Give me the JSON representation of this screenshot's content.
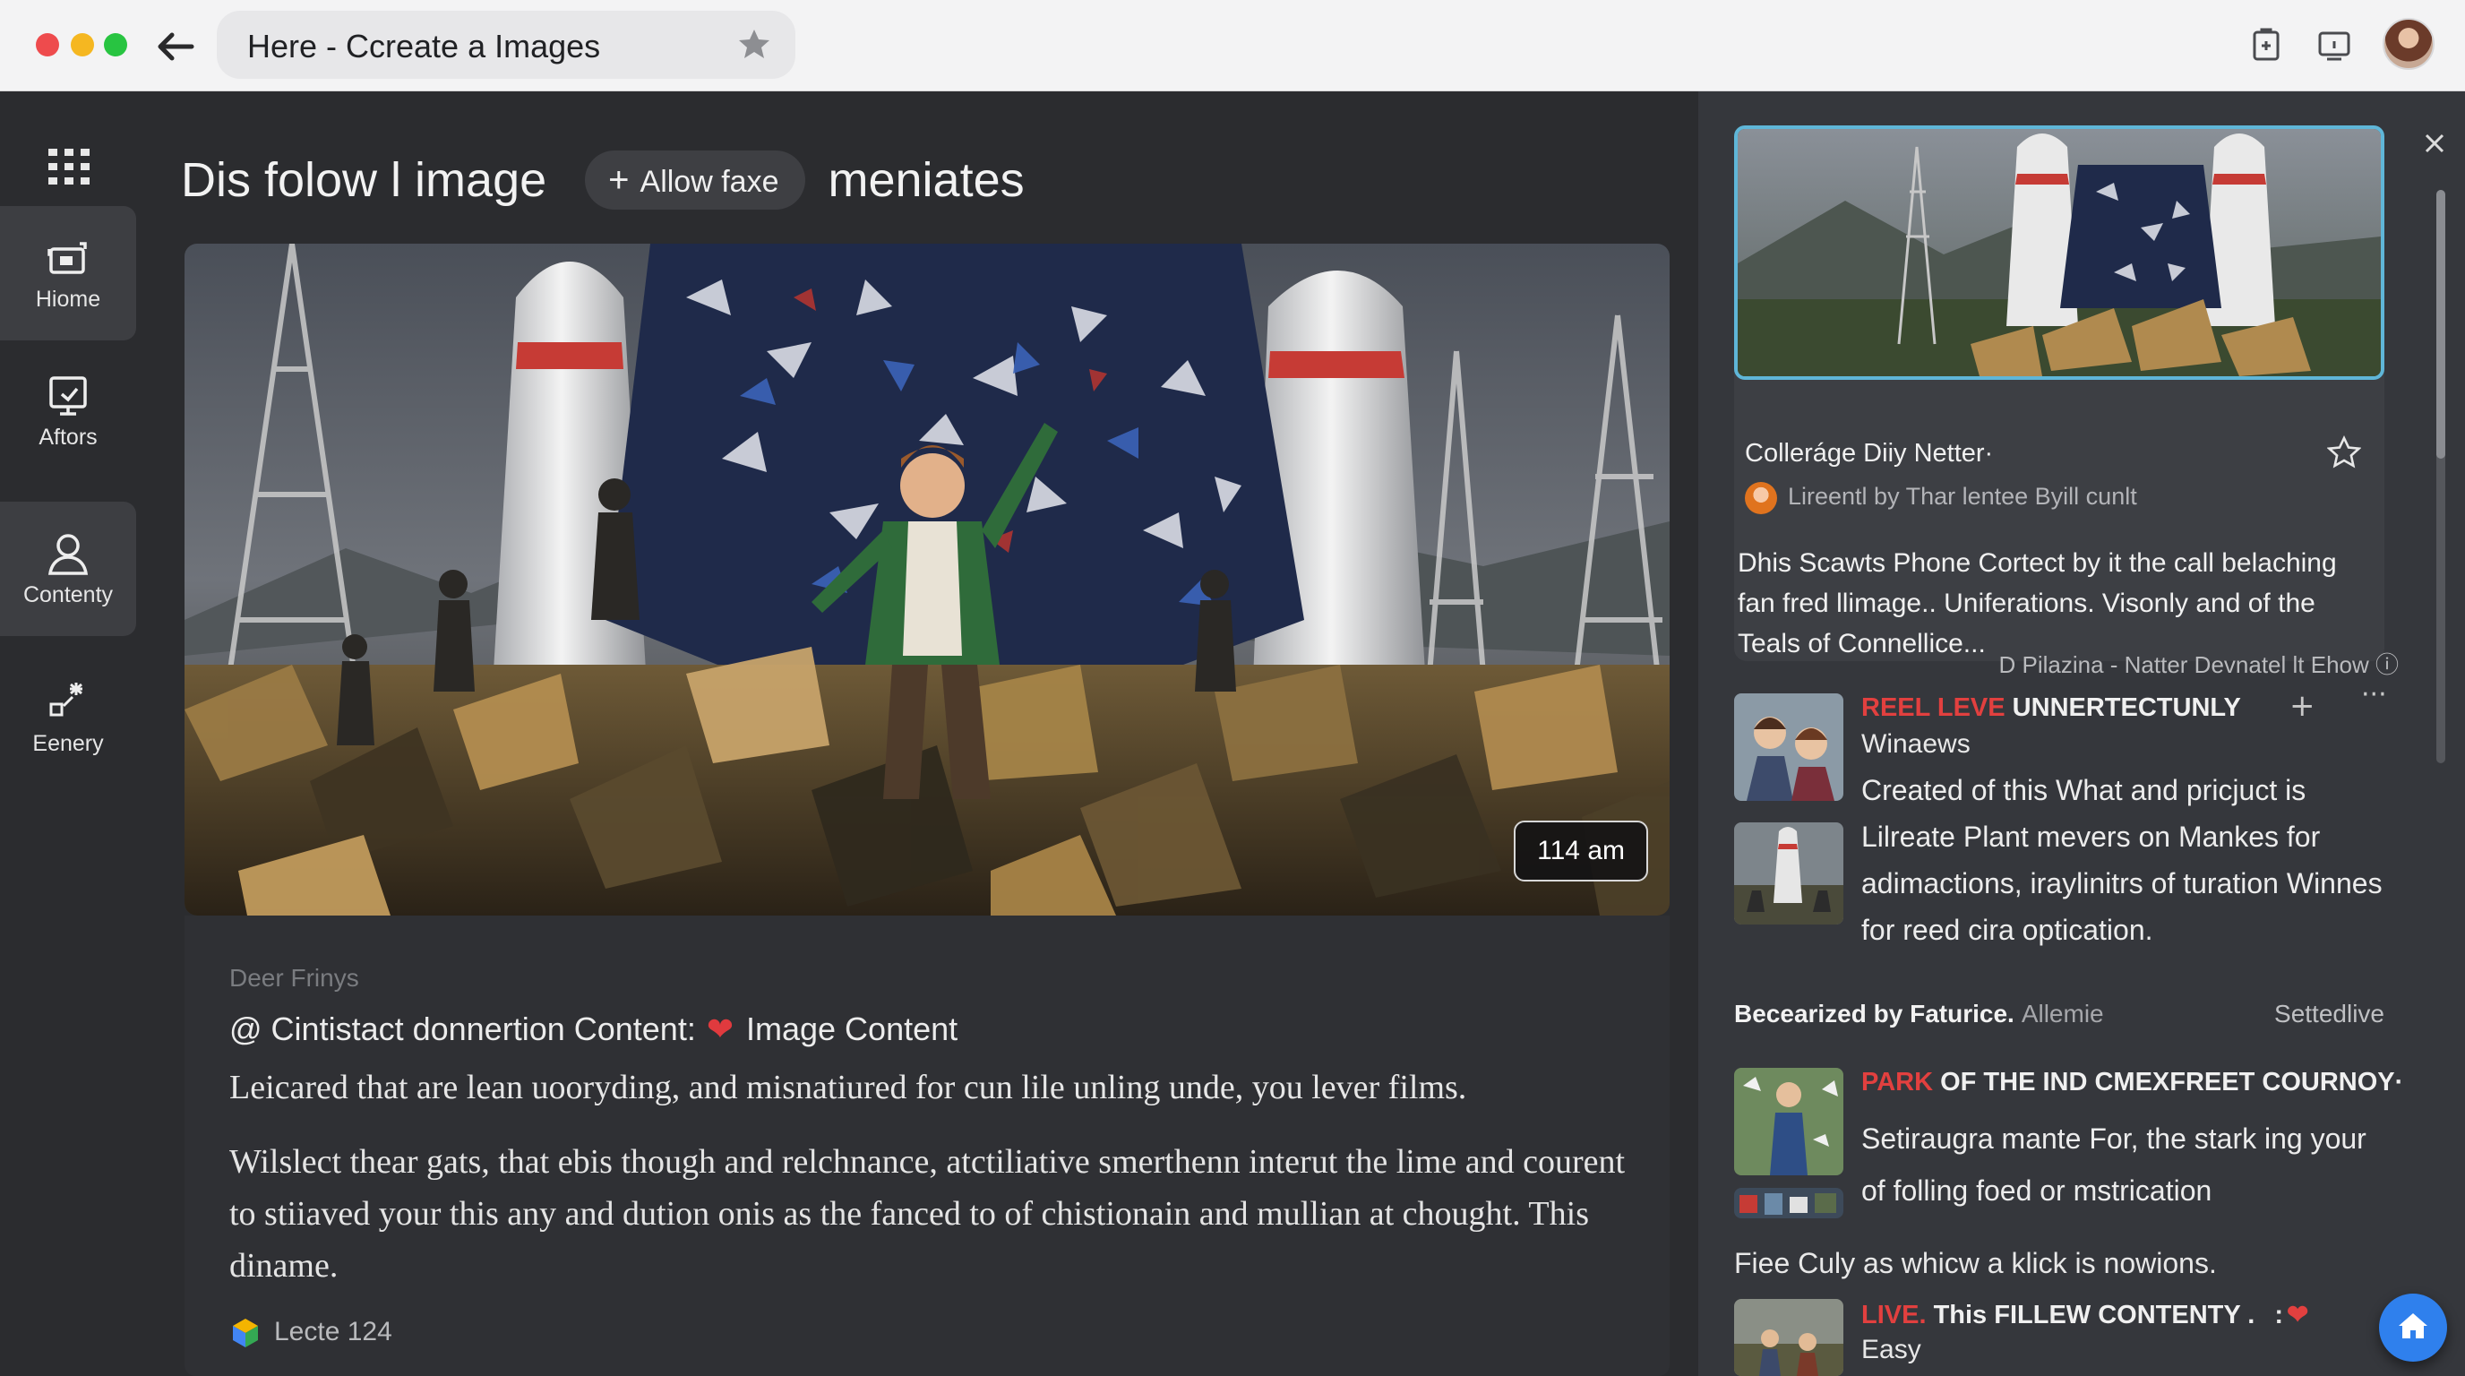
{
  "browser": {
    "tab_title": "Here - Ccreate a Images"
  },
  "sidebar": {
    "items": [
      {
        "label": "Hiome",
        "icon": "home-icon"
      },
      {
        "label": "Aftors",
        "icon": "monitor-icon"
      },
      {
        "label": "Contenty",
        "icon": "user-icon"
      },
      {
        "label": "Eenery",
        "icon": "sparkle-icon"
      }
    ]
  },
  "main": {
    "title_part1": "Dis folow l image",
    "allow_button": "Allow faxe",
    "title_part2": "meniates",
    "time_badge": "114 am",
    "meta": "Deer Frinys",
    "line1_prefix": "@ Cintistact donnertion Content:",
    "line1_suffix": "Image Content",
    "line2": "Leicared that are lean uooryding, and misnatiured for cun lile unling unde, you lever films.",
    "paragraph": "Wilslect thear gats, that ebis though and relchnance, atctiliative smerthenn interut the lime and courent to stiiaved your this any and dution onis as the fanced to of chistionain and mullian at chought. This diname.",
    "footer": "Lecte 124"
  },
  "panel": {
    "featured": {
      "title": "Colleráge Diiy Netter·",
      "byline": "Lireentl by Thar lentee Byill cunlt",
      "description": "Dhis Scawts Phone Cortect by it the call belaching fan fred llimage.. Uniferations. Visonly and of the Teals of Connellice...",
      "credit": "D Pilazina - Natter Devnatel lt Ehow ⓘ"
    },
    "news1": {
      "headline_red": "REEL LEVE",
      "headline_rest": " UNNERTECTUNLY",
      "sub": "Winaews",
      "body": "Created of this What and pricjuct is Lilreate Plant mevers on Mankes for adimactions, iraylinitrs of turation Winnes for reed cira optication."
    },
    "section": {
      "strong": "Becearized by Faturice.",
      "muted": "Allemie",
      "right": "Settedlive"
    },
    "news2": {
      "headline_red": "PARK",
      "headline_rest": " OF THE IND CMEXFREET COURNOY·",
      "body": "Setiraugra mante For, the stark ing your of folling foed or mstrication",
      "tail": "Fiee Culy as whicw a klick is nowions."
    },
    "news3": {
      "headline_red": "LIVE.",
      "headline_rest": " This FILLEW CONTENTY .",
      "sub": "Easy"
    }
  },
  "colors": {
    "accent_blue": "#2f80ed",
    "highlight_red": "#e2403f",
    "frame_blue": "#5fb6d8"
  }
}
